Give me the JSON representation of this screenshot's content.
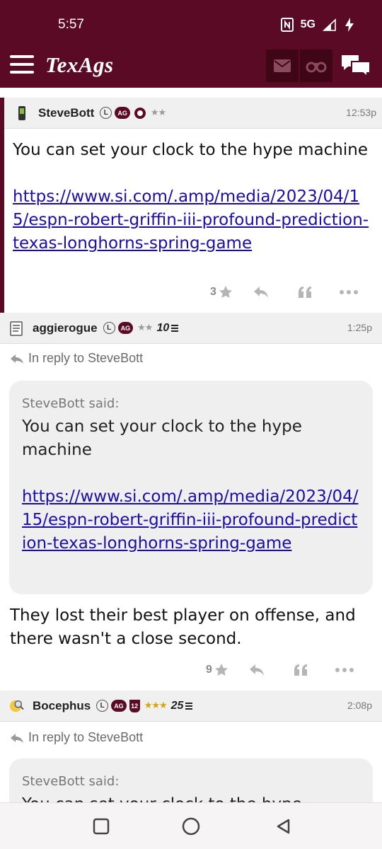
{
  "status": {
    "time": "5:57",
    "network": "5G"
  },
  "app": {
    "logo": "TexAgs"
  },
  "posts": [
    {
      "user": "SteveBott",
      "time": "12:53p",
      "stars": "★★",
      "text": "You can set your clock to the hype machine",
      "link": "https://www.si.com/.amp/media/2023/04/15/espn-robert-griffin-iii-profound-prediction-texas-longhorns-spring-game",
      "likes": "3"
    },
    {
      "user": "aggierogue",
      "time": "1:25p",
      "stars": "★★",
      "tier": "10",
      "reply_to": "In reply to SteveBott",
      "quote_author": "SteveBott said:",
      "quote_text": "You can set your clock to the hype machine",
      "quote_link": "https://www.si.com/.amp/media/2023/04/15/espn-robert-griffin-iii-profound-prediction-texas-longhorns-spring-game",
      "text": "They lost their best player on offense, and there wasn't a close second.",
      "likes": "9"
    },
    {
      "user": "Bocephus",
      "time": "2:08p",
      "stars": "★★★",
      "tier": "25",
      "reply_to": "In reply to SteveBott",
      "quote_author": "SteveBott said:",
      "quote_text": "You can set your clock to the hype machine"
    }
  ],
  "badges": {
    "l": "L",
    "ag": "AG",
    "shield": "12"
  },
  "colors": {
    "maroon": "#5b0a25",
    "link": "#1a0dab"
  }
}
